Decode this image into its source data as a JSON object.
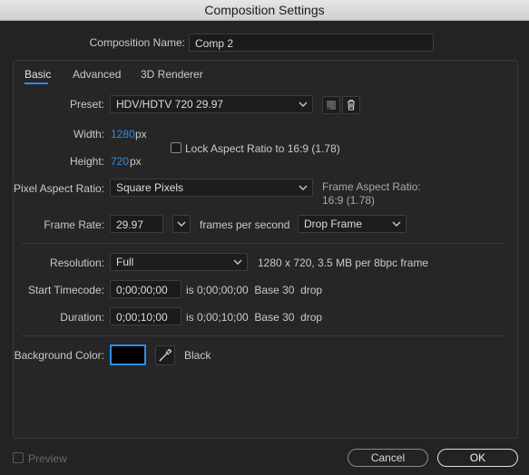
{
  "window": {
    "title": "Composition Settings"
  },
  "comp_name": {
    "label": "Composition Name:",
    "value": "Comp 2"
  },
  "tabs": [
    {
      "label": "Basic"
    },
    {
      "label": "Advanced"
    },
    {
      "label": "3D Renderer"
    }
  ],
  "preset": {
    "label": "Preset:",
    "value": "HDV/HDTV 720 29.97"
  },
  "width": {
    "label": "Width:",
    "value": "1280",
    "unit": "px"
  },
  "height": {
    "label": "Height:",
    "value": "720",
    "unit": "px"
  },
  "lock_aspect": {
    "label": "Lock Aspect Ratio to 16:9 (1.78)",
    "checked": false
  },
  "pixel_aspect": {
    "label": "Pixel Aspect Ratio:",
    "value": "Square Pixels"
  },
  "frame_aspect": {
    "label": "Frame Aspect Ratio:",
    "value": "16:9 (1.78)"
  },
  "frame_rate": {
    "label": "Frame Rate:",
    "value": "29.97",
    "unit": "frames per second",
    "drop_value": "Drop Frame"
  },
  "resolution": {
    "label": "Resolution:",
    "value": "Full",
    "info": "1280 x 720, 3.5 MB per 8bpc frame"
  },
  "start_timecode": {
    "label": "Start Timecode:",
    "value": "0;00;00;00",
    "info": "is 0;00;00;00  Base 30  drop"
  },
  "duration": {
    "label": "Duration:",
    "value": "0;00;10;00",
    "info": "is 0;00;10;00  Base 30  drop"
  },
  "background": {
    "label": "Background Color:",
    "color": "#000000",
    "name": "Black"
  },
  "footer": {
    "preview_label": "Preview",
    "cancel_label": "Cancel",
    "ok_label": "OK"
  },
  "colors": {
    "accent": "#2d8ceb",
    "background": "#232323"
  }
}
